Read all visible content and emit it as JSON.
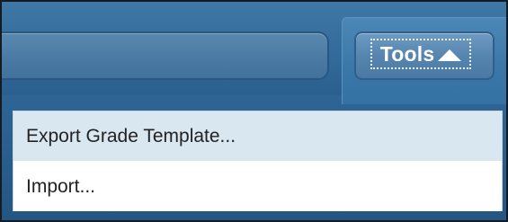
{
  "toolbar": {
    "tools_button_label": "Tools",
    "tools_arrow_icon": "triangle-up-icon"
  },
  "menu": {
    "items": [
      {
        "label": "Export Grade Template...",
        "highlighted": true
      },
      {
        "label": "Import...",
        "highlighted": false
      }
    ]
  },
  "colors": {
    "toolbar_blue": "#336c9c",
    "menu_highlight": "#d9e7f1",
    "menu_background": "#ffffff"
  }
}
